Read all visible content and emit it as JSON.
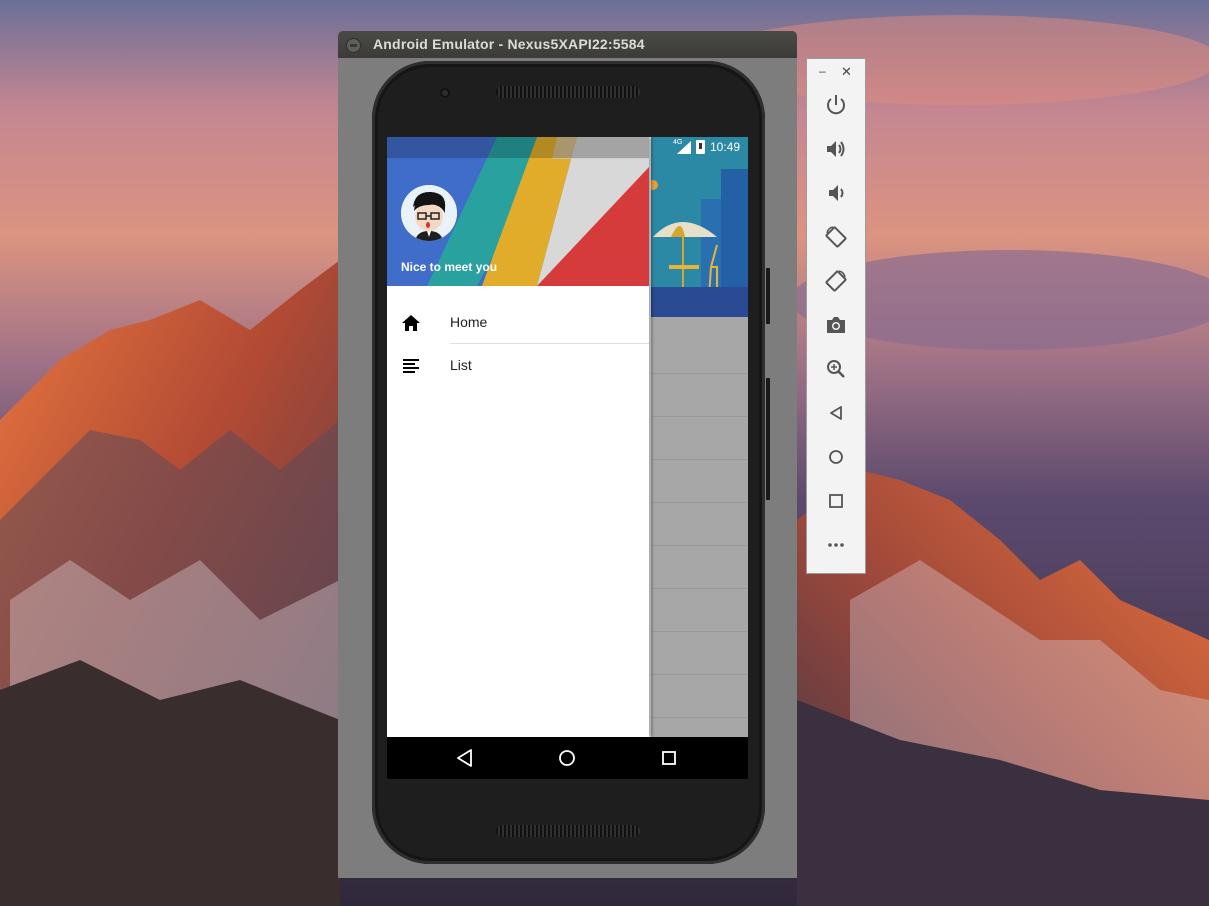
{
  "emulator": {
    "title": "Android Emulator - Nexus5XAPI22:5584"
  },
  "statusbar": {
    "network": "4G",
    "time": "10:49"
  },
  "drawer": {
    "header_text": "Nice to meet you",
    "items": [
      {
        "label": "Home",
        "icon": "home-icon"
      },
      {
        "label": "List",
        "icon": "list-icon"
      }
    ]
  },
  "toolbar": {
    "minimize_label": "–",
    "close_label": "✕",
    "buttons": [
      "power-icon",
      "volume-up-icon",
      "volume-down-icon",
      "rotate-left-icon",
      "rotate-right-icon",
      "camera-icon",
      "zoom-icon",
      "back-icon",
      "home-circle-icon",
      "overview-icon",
      "more-icon"
    ]
  },
  "colors": {
    "header_blue": "#3f6dc9",
    "header_red": "#d53b3b",
    "header_yellow": "#e0ac2a",
    "header_teal": "#26a69a"
  }
}
